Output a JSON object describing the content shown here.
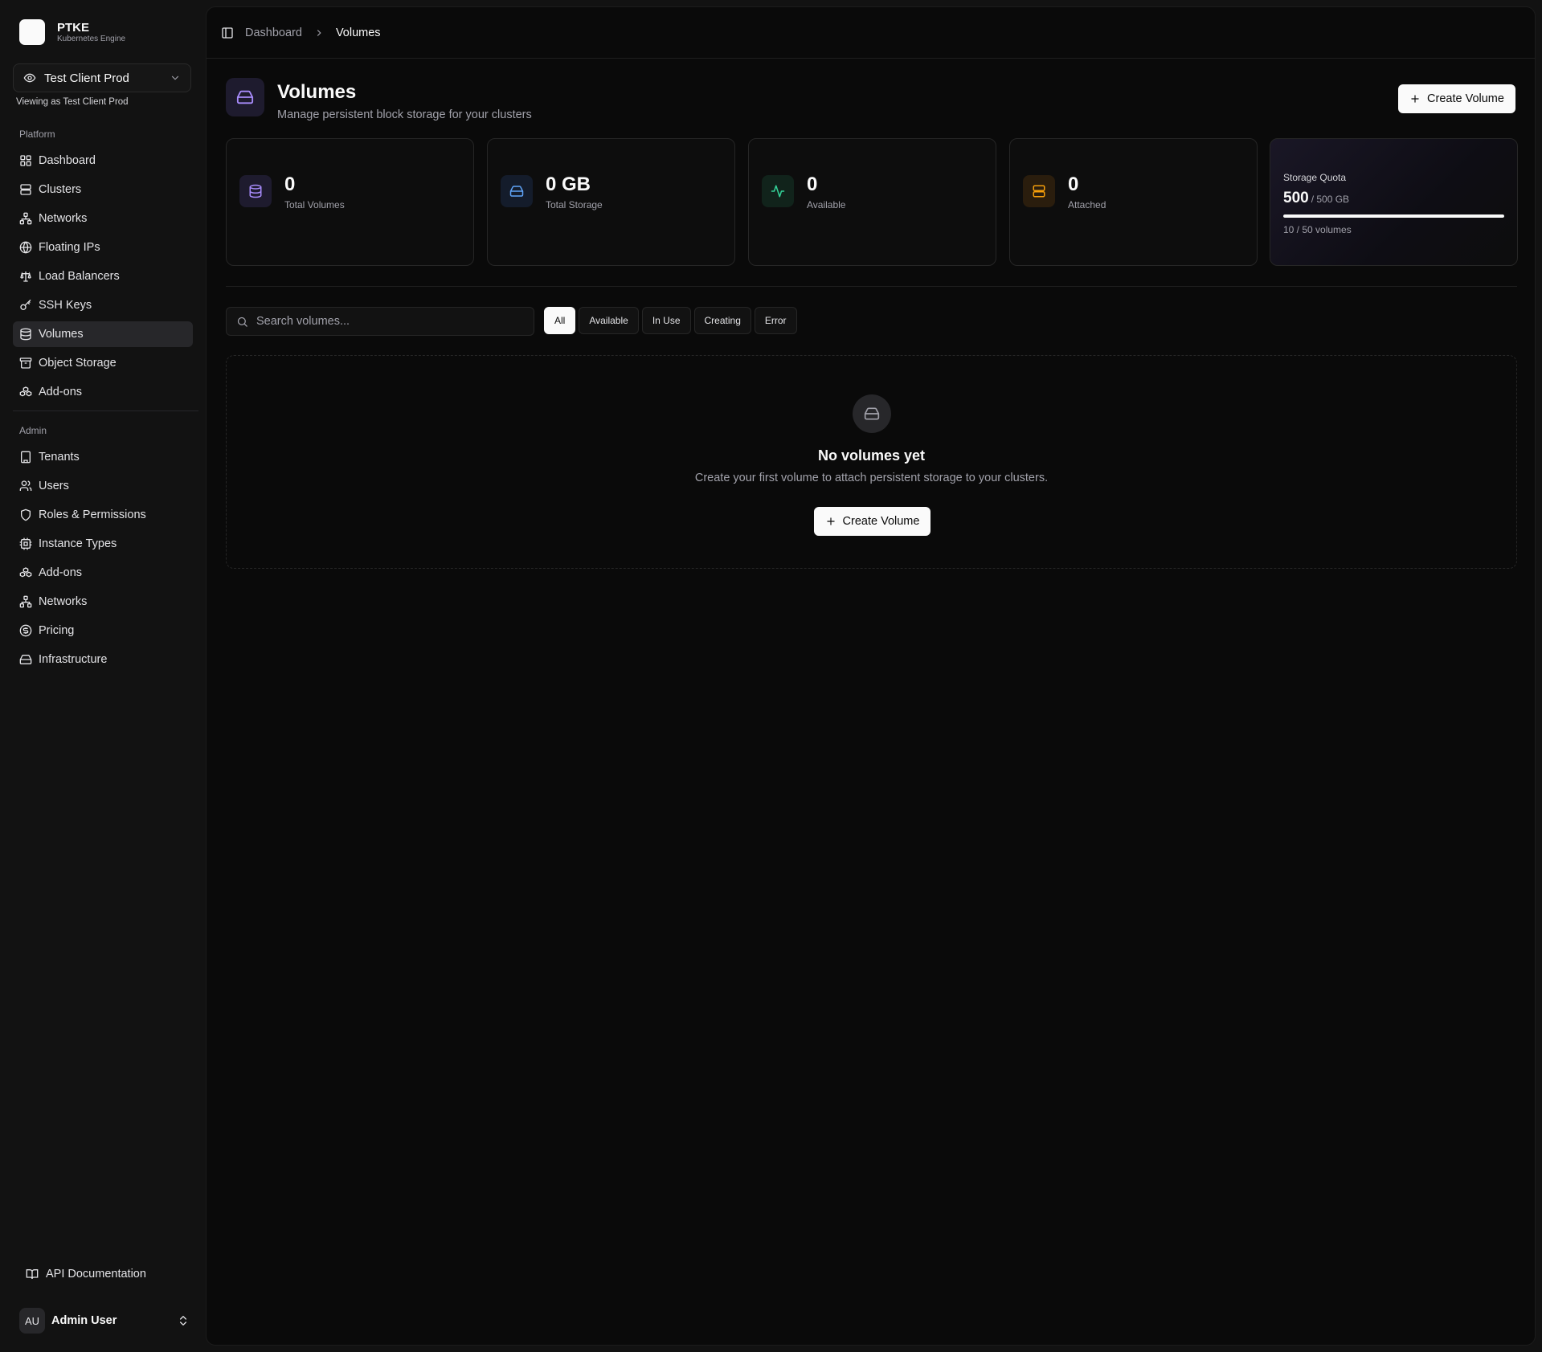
{
  "brand": {
    "name": "PTKE",
    "subtitle": "Kubernetes Engine"
  },
  "tenant": {
    "selected": "Test Client Prod",
    "viewing_as": "Viewing as Test Client Prod"
  },
  "sidebar": {
    "platform_label": "Platform",
    "platform_items": [
      {
        "label": "Dashboard",
        "icon": "grid-icon"
      },
      {
        "label": "Clusters",
        "icon": "server-icon"
      },
      {
        "label": "Networks",
        "icon": "network-icon"
      },
      {
        "label": "Floating IPs",
        "icon": "globe-icon"
      },
      {
        "label": "Load Balancers",
        "icon": "scale-icon"
      },
      {
        "label": "SSH Keys",
        "icon": "key-icon"
      },
      {
        "label": "Volumes",
        "icon": "database-icon",
        "active": true
      },
      {
        "label": "Object Storage",
        "icon": "archive-icon"
      },
      {
        "label": "Add-ons",
        "icon": "boxes-icon"
      }
    ],
    "admin_label": "Admin",
    "admin_items": [
      {
        "label": "Tenants",
        "icon": "building-icon"
      },
      {
        "label": "Users",
        "icon": "users-icon"
      },
      {
        "label": "Roles & Permissions",
        "icon": "shield-icon"
      },
      {
        "label": "Instance Types",
        "icon": "cpu-icon"
      },
      {
        "label": "Add-ons",
        "icon": "boxes-icon"
      },
      {
        "label": "Networks",
        "icon": "network-icon"
      },
      {
        "label": "Pricing",
        "icon": "dollar-icon"
      },
      {
        "label": "Infrastructure",
        "icon": "hard-drive-icon"
      }
    ],
    "api_docs": "API Documentation",
    "user": {
      "initials": "AU",
      "name": "Admin User"
    }
  },
  "breadcrumb": {
    "parent": "Dashboard",
    "current": "Volumes"
  },
  "page": {
    "title": "Volumes",
    "description": "Manage persistent block storage for your clusters",
    "create_button": "Create Volume"
  },
  "stats": {
    "total_volumes": {
      "value": "0",
      "label": "Total Volumes"
    },
    "total_storage": {
      "value": "0 GB",
      "label": "Total Storage"
    },
    "available": {
      "value": "0",
      "label": "Available"
    },
    "attached": {
      "value": "0",
      "label": "Attached"
    },
    "quota": {
      "title": "Storage Quota",
      "value": "500",
      "of": "/ 500 GB",
      "fill_fraction": 1.0,
      "volumes": "10 / 50 volumes"
    }
  },
  "search": {
    "placeholder": "Search volumes..."
  },
  "filters": [
    "All",
    "Available",
    "In Use",
    "Creating",
    "Error"
  ],
  "empty_state": {
    "title": "No volumes yet",
    "description": "Create your first volume to attach persistent storage to your clusters.",
    "button": "Create Volume"
  },
  "colors": {
    "accent_purple": "#a78bfa",
    "accent_blue": "#60a5fa",
    "accent_green": "#34d399",
    "accent_orange": "#f59e0b"
  }
}
